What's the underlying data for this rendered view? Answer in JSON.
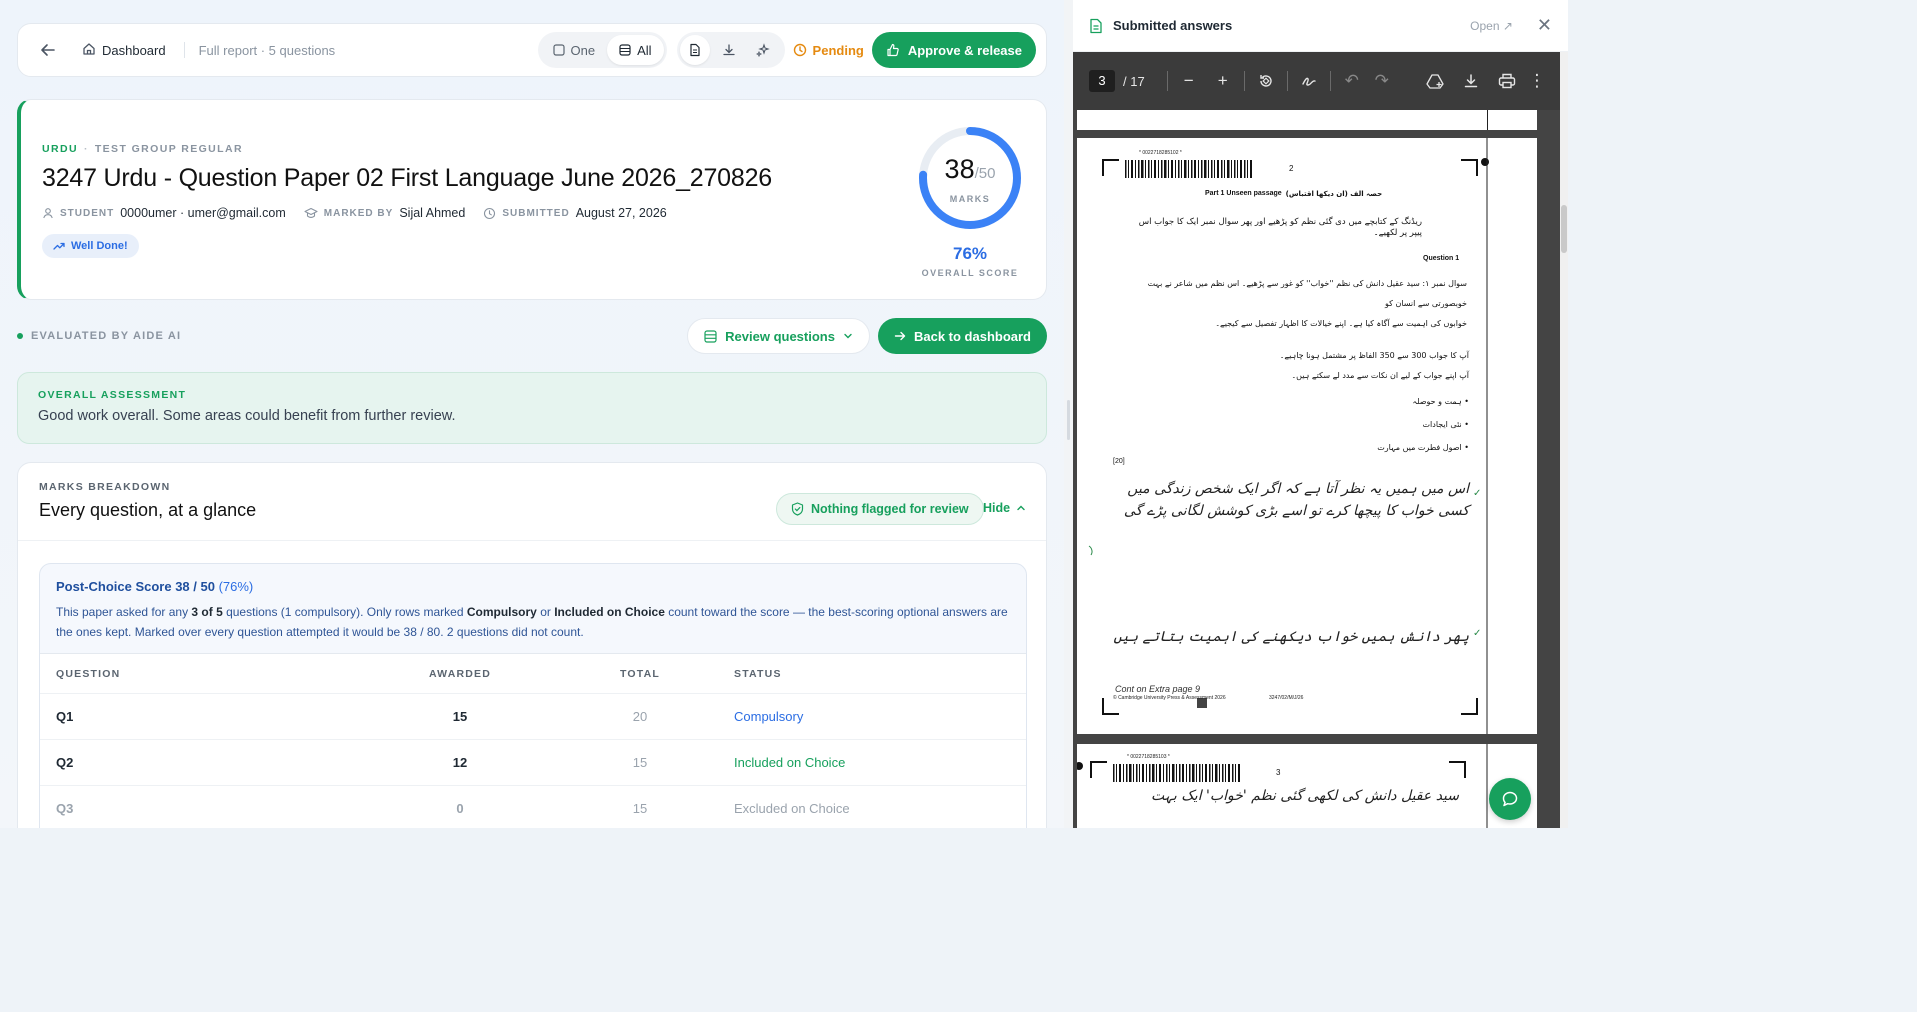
{
  "topbar": {
    "dashboard_label": "Dashboard",
    "report_info": "Full report · 5 questions",
    "view_one": "One",
    "view_all": "All",
    "status": "Pending",
    "approve_label": "Approve & release"
  },
  "hero": {
    "subject": "URDU",
    "group": "TEST GROUP REGULAR",
    "title": "3247 Urdu - Question Paper 02 First Language June 2026_270826",
    "student_label": "STUDENT",
    "student_value": "0000umer · umer@gmail.com",
    "marked_label": "MARKED BY",
    "marked_value": "Sijal Ahmed",
    "submitted_label": "SUBMITTED",
    "submitted_value": "August 27, 2026",
    "badge": "Well Done!",
    "score": "38",
    "score_total": "/50",
    "marks_label": "MARKS",
    "percent": "76%",
    "overall_label": "OVERALL SCORE",
    "score_fraction": 0.76
  },
  "eval": {
    "label": "EVALUATED BY AIDE AI",
    "review_label": "Review questions",
    "back_label": "Back to dashboard"
  },
  "assessment": {
    "title": "OVERALL ASSESSMENT",
    "text": "Good work overall. Some areas could benefit from further review."
  },
  "breakdown": {
    "title": "MARKS BREAKDOWN",
    "heading": "Every question, at a glance",
    "flag_label": "Nothing flagged for review",
    "hide_label": "Hide",
    "score_title": "Post-Choice Score 38 / 50",
    "score_pct": "(76%)",
    "desc_1": "This paper asked for any ",
    "desc_b1": "3 of 5",
    "desc_2": " questions (1 compulsory). Only rows marked ",
    "desc_b2": "Compulsory",
    "desc_3": " or ",
    "desc_b3": "Included on Choice",
    "desc_4": " count toward the score — the best-scoring optional answers are the ones kept. Marked over every question attempted it would be 38 / 80. 2 questions did not count.",
    "columns": [
      "QUESTION",
      "AWARDED",
      "TOTAL",
      "STATUS"
    ],
    "rows": [
      {
        "q": "Q1",
        "awarded": "15",
        "total": "20",
        "status": "Compulsory"
      },
      {
        "q": "Q2",
        "awarded": "12",
        "total": "15",
        "status": "Included on Choice"
      },
      {
        "q": "Q3",
        "awarded": "0",
        "total": "15",
        "status": "Excluded on Choice"
      }
    ]
  },
  "panel": {
    "title": "Submitted answers",
    "open_label": "Open ↗",
    "page_current": "3",
    "page_total": "/ 17"
  },
  "pdf": {
    "barcode_1": "* 0022718285102 *",
    "page_no_1": "2",
    "section_heading": "Part 1 Unseen passage",
    "section_urdu": "حصہ الف (ان دیکھا اقتباس)",
    "instruction": "ریڈنگ کے کتابچے میں دی گئی نظم کو پڑھیے اور پھر سوال نمبر ایک کا جواب اس پیپر پر لکھیے۔",
    "question_label": "Question 1",
    "q_line_1": "سوال نمبر ۱: سید عقیل دانش کی نظم ''خواب'' کو غور سے پڑھیے۔ اس نظم میں شاعر نے بہت خوبصورتی سے انسان کو",
    "q_line_2": "خوابوں کی اہمیت سے آگاہ کیا ہے۔ اپنے خیالات کا اظہار تفصیل سے کیجیے۔",
    "rule_1": "آپ کا جواب 300 سے 350 الفاظ پر مشتمل ہونا چاہیے۔",
    "rule_2": "آپ اپنے جواب کے لیے ان نکات سے مدد لے سکتے ہیں۔",
    "bullets": [
      "ہمت و حوصلہ",
      "نئی ایجادات",
      "اصول فطرت میں مہارت"
    ],
    "marks": "[20]",
    "handwriting_1": "اس میں ہمیں یہ نظر آتا ہے کہ اگر ایک شخص زندگی میں کسی خواب کا پیچھا کرے تو اسے بڑی کوشش لگانی پڑے گی",
    "handwriting_2": "پھر دانش ہمیں خواب دیکھنے کی اہمیت بتاتے ہیں",
    "cont_note": "Cont on Extra page 9",
    "footer_left": "© Cambridge University Press & Assessment 2026",
    "footer_right": "3247/02/M/J/26",
    "barcode_2": "* 0022718285103 *",
    "page_no_2": "3",
    "handwriting_3": "سید عقیل دانش کی لکھی گئی نظم 'خواب' ایک بہت"
  }
}
